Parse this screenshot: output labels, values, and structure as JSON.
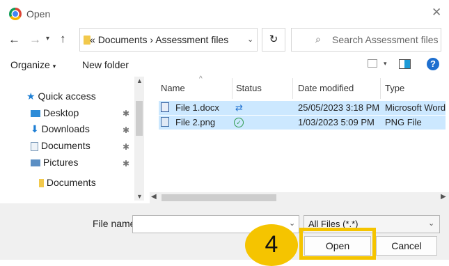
{
  "window": {
    "title": "Open"
  },
  "address_bar": {
    "chevron": "«",
    "path": [
      "Documents",
      "Assessment files"
    ],
    "separator": "›"
  },
  "search": {
    "placeholder": "Search Assessment files"
  },
  "toolbar": {
    "organize": "Organize",
    "new_folder": "New folder"
  },
  "sidebar": {
    "items": [
      {
        "label": "Quick access",
        "icon": "star-icon"
      },
      {
        "label": "Desktop",
        "icon": "desktop-icon"
      },
      {
        "label": "Downloads",
        "icon": "download-icon"
      },
      {
        "label": "Documents",
        "icon": "documents-icon"
      },
      {
        "label": "Pictures",
        "icon": "pictures-icon"
      },
      {
        "label": "Documents",
        "icon": "folder-icon"
      }
    ]
  },
  "file_list": {
    "columns": [
      "Name",
      "Status",
      "Date modified",
      "Type"
    ],
    "rows": [
      {
        "name": "File 1.docx",
        "status": "sync",
        "date": "25/05/2023 3:18 PM",
        "type": "Microsoft Word"
      },
      {
        "name": "File 2.png",
        "status": "available",
        "date": "1/03/2023 5:09 PM",
        "type": "PNG File"
      }
    ]
  },
  "footer": {
    "file_name_label": "File name:",
    "file_name_value": "",
    "filter": "All Files (*.*)",
    "open_label": "Open",
    "cancel_label": "Cancel"
  },
  "annotation": {
    "step_number": "4"
  },
  "colors": {
    "selection": "#cce8ff",
    "highlight": "#f5c400",
    "accent": "#1e6fcf"
  }
}
